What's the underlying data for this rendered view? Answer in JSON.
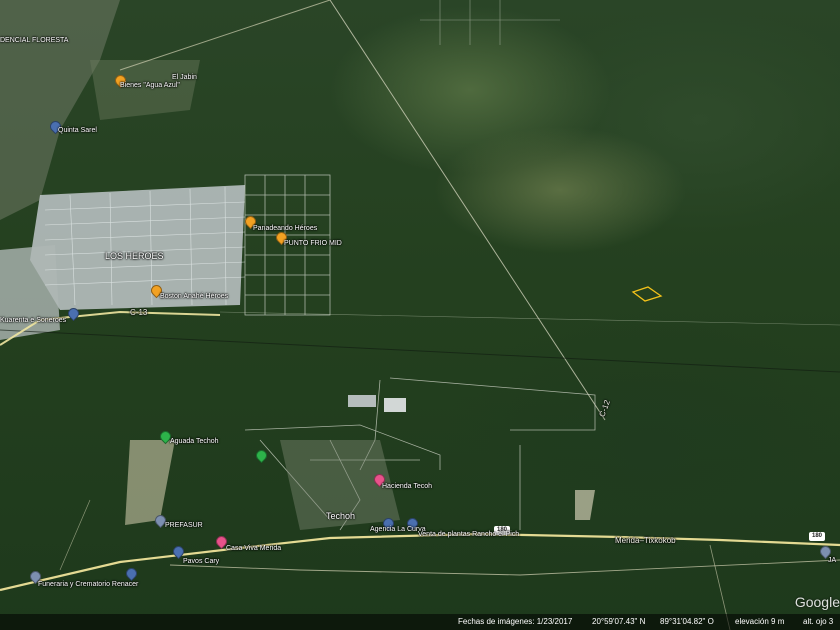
{
  "labels": {
    "floresta": "DENCIAL FLORESTA",
    "el_jabin": "El Jabin",
    "aguacate": "Bienes \"Agua Azul\"",
    "quinta": "Quinta Sarel",
    "los_heroes": "LOS HEROES",
    "panadeando": "Panadeando Héroes",
    "punto_frio": "PUNTO FRIO MID",
    "anahe": "Boston Anahé Héroes",
    "kuarenta": "Kuarenta e Soneroes",
    "c13": "C-13",
    "c12": "C-12",
    "aguada": "Aguada Techoh",
    "hacienda": "Hacienda Tecoh",
    "techoh": "Techoh",
    "agencia": "Agencia La Curva",
    "venta": "Venta de plantas Rancho el Pich",
    "merida": "Merida–Tixkokob",
    "prefasur": "PREFASUR",
    "casa_viva": "Casa Viva Merida",
    "pavos": "Pavos Cary",
    "funeraria": "Funeraria y Crematorio Renacer",
    "ja": "JA",
    "shield_180_a": "180",
    "shield_180_b": "180"
  },
  "footer": {
    "imagery_date": "Fechas de imágenes: 1/23/2017",
    "lat": "20°59'07.43\" N",
    "lon": "89°31'04.82\" O",
    "elevation": "elevación    9 m",
    "eye_alt": "alt. ojo  3"
  },
  "logo": "Google"
}
